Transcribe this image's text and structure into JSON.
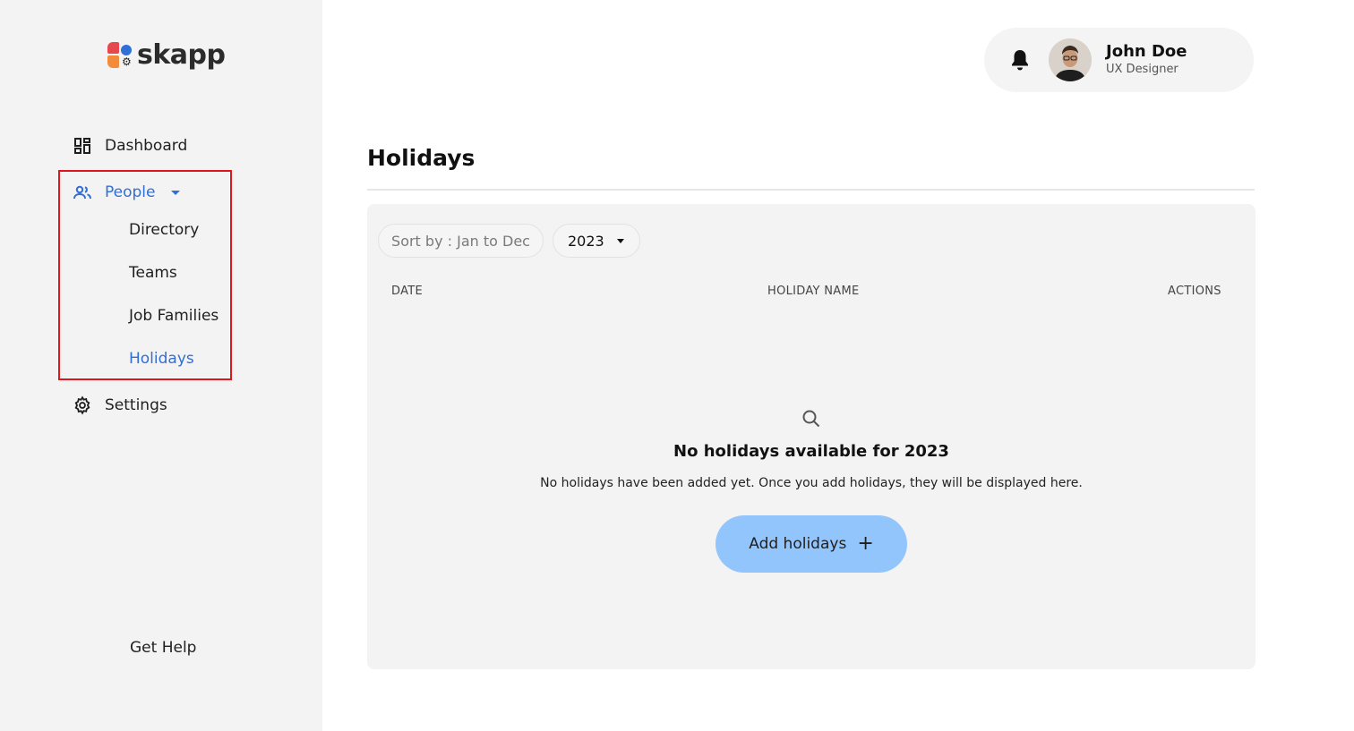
{
  "brand": {
    "name": "skapp"
  },
  "sidebar": {
    "dashboard": "Dashboard",
    "people": "People",
    "people_items": [
      "Directory",
      "Teams",
      "Job Families",
      "Holidays"
    ],
    "settings": "Settings",
    "help": "Get Help"
  },
  "header": {
    "user_name": "John Doe",
    "user_role": "UX Designer"
  },
  "page": {
    "title": "Holidays",
    "sort_label": "Sort by : Jan to Dec",
    "year": "2023",
    "columns": [
      "DATE",
      "HOLIDAY NAME",
      "ACTIONS"
    ],
    "empty_title": "No holidays available for 2023",
    "empty_desc": "No holidays have been added yet. Once you add holidays, they will be displayed here.",
    "add_button": "Add holidays"
  },
  "colors": {
    "accent": "#2f6fd6",
    "highlight_border": "#e0161c",
    "button_bg": "#93c5fd"
  }
}
